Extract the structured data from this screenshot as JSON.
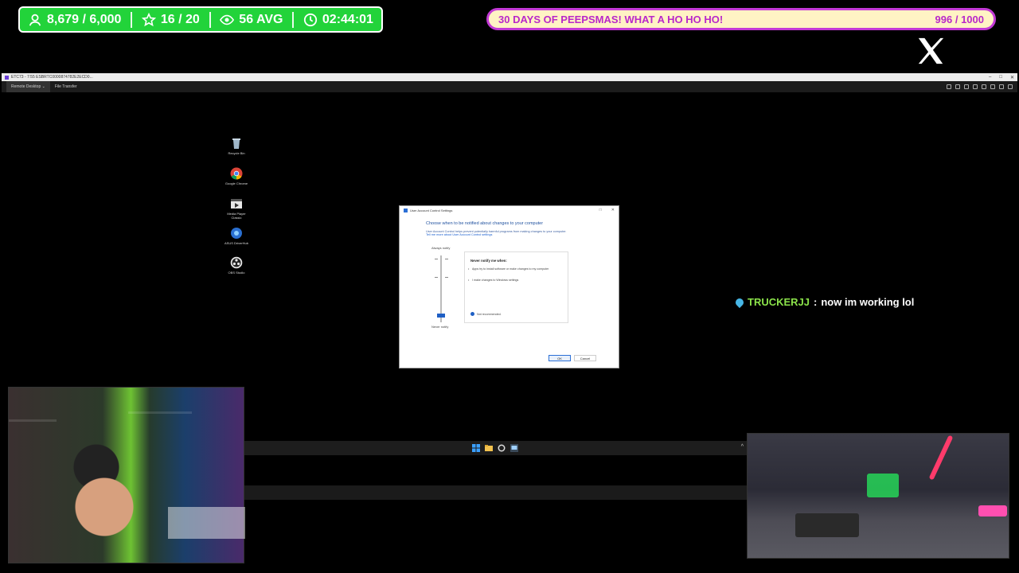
{
  "overlay": {
    "stats": [
      {
        "icon": "person-icon",
        "value": "8,679 / 6,000"
      },
      {
        "icon": "star-icon",
        "value": "16 / 20"
      },
      {
        "icon": "eye-icon",
        "value": "56 AVG"
      },
      {
        "icon": "clock-icon",
        "value": "02:44:01"
      }
    ],
    "goal": {
      "label": "30 DAYS OF PEEPSMAS! WHAT A HO HO HO!",
      "progress": "996 / 1000"
    },
    "colors": {
      "stats_bg": "#22d33a",
      "goal_bg": "#fff3c4",
      "goal_border": "#c33ad6"
    }
  },
  "remote_window": {
    "title": "ETC73 - 7:55 ESBRTC0000874782E2ECD0...",
    "tabs": [
      "Remote Desktop",
      "File Transfer"
    ]
  },
  "desktop_icons": [
    {
      "label": "Recycle Bin"
    },
    {
      "label": "Google Chrome"
    },
    {
      "label": "Media Player Classic"
    },
    {
      "label": "ASUS DriverHub"
    },
    {
      "label": "OBS Studio"
    }
  ],
  "uac_dialog": {
    "title": "User Account Control Settings",
    "heading": "Choose when to be notified about changes to your computer",
    "description": "User Account Control helps prevent potentially harmful programs from making changes to your computer.",
    "link": "Tell me more about User Account Control settings",
    "always_label": "Always notify",
    "never_label": "Never notify",
    "box_heading": "Never notify me when:",
    "bullets": [
      "Apps try to install software or make changes to my computer",
      "I make changes to Windows settings"
    ],
    "note": "Not recommended.",
    "ok_label": "OK",
    "cancel_label": "Cancel"
  },
  "chat": {
    "user": "TRUCKERJJ",
    "separator": ":",
    "message": "now im working lol"
  }
}
